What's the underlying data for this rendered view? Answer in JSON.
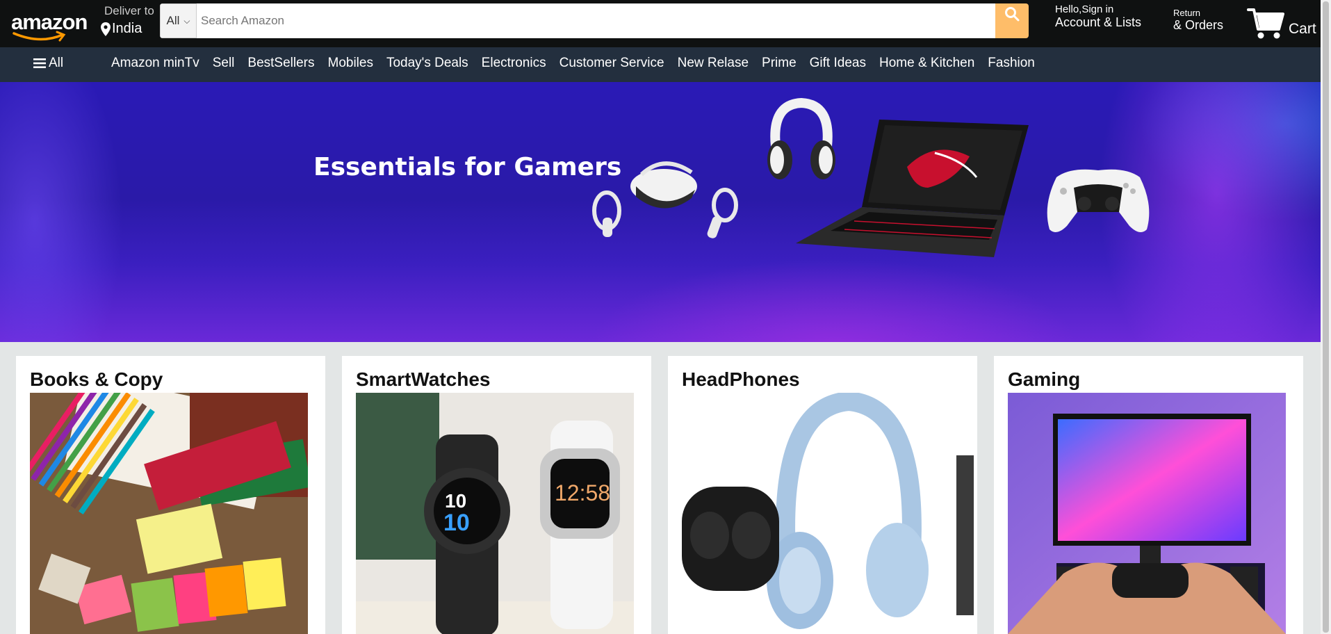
{
  "header": {
    "logo_text": "amazon",
    "deliver_label": "Deliver to",
    "deliver_location": "India",
    "search_category": "All",
    "search_placeholder": "Search Amazon",
    "account_greeting": "Hello,Sign in",
    "account_label": "Account & Lists",
    "orders_small": "Return",
    "orders_big": "& Orders",
    "cart_label": "Cart"
  },
  "subnav": {
    "all_label": "All",
    "links": [
      "Amazon minTv",
      "Sell",
      "BestSellers",
      "Mobiles",
      "Today's Deals",
      "Electronics",
      "Customer Service",
      "New Relase",
      "Prime",
      "Gift Ideas",
      "Home & Kitchen",
      "Fashion"
    ]
  },
  "hero": {
    "title": "Essentials for Gamers"
  },
  "cards": [
    {
      "title": "Books & Copy",
      "image": "stationery-image"
    },
    {
      "title": "SmartWatches",
      "image": "smartwatches-image"
    },
    {
      "title": "HeadPhones",
      "image": "headphones-image"
    },
    {
      "title": "Gaming",
      "image": "gaming-image"
    }
  ],
  "colors": {
    "header_bg": "#0f1111",
    "subnav_bg": "#232f3e",
    "search_button": "#febd69",
    "hero_bg": "#2a1ab6",
    "page_bg": "#e3e6e6"
  }
}
